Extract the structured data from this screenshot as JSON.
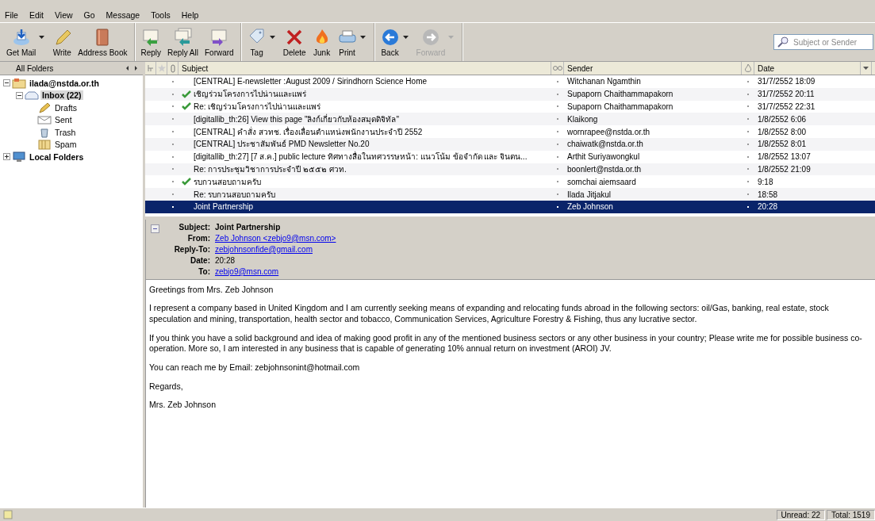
{
  "menu": [
    "File",
    "Edit",
    "View",
    "Go",
    "Message",
    "Tools",
    "Help"
  ],
  "toolbar": [
    [
      {
        "label": "Get Mail",
        "kind": "getmail",
        "dropdown": true,
        "disabled": false
      },
      {
        "label": "Write",
        "kind": "write",
        "dropdown": false,
        "disabled": false
      },
      {
        "label": "Address Book",
        "kind": "addressbook",
        "dropdown": false,
        "disabled": false
      }
    ],
    [
      {
        "label": "Reply",
        "kind": "reply",
        "dropdown": false,
        "disabled": false
      },
      {
        "label": "Reply All",
        "kind": "replyall",
        "dropdown": false,
        "disabled": false
      },
      {
        "label": "Forward",
        "kind": "forward",
        "dropdown": false,
        "disabled": false
      }
    ],
    [
      {
        "label": "Tag",
        "kind": "tag",
        "dropdown": true,
        "disabled": false
      },
      {
        "label": "Delete",
        "kind": "delete",
        "dropdown": false,
        "disabled": false
      },
      {
        "label": "Junk",
        "kind": "junk",
        "dropdown": false,
        "disabled": false
      },
      {
        "label": "Print",
        "kind": "print",
        "dropdown": true,
        "disabled": false
      }
    ],
    [
      {
        "label": "Back",
        "kind": "back",
        "dropdown": true,
        "disabled": false
      },
      {
        "label": "Forward",
        "kind": "next",
        "dropdown": true,
        "disabled": true
      }
    ]
  ],
  "search": {
    "placeholder": "Subject or Sender"
  },
  "folders": {
    "header": "All Folders",
    "tree": [
      {
        "label": "ilada@nstda.or.th",
        "kind": "account",
        "expanded": true,
        "selected": false,
        "children": [
          {
            "label": "Inbox (22)",
            "kind": "inbox",
            "expanded": true,
            "selected": true,
            "children": [
              {
                "label": "Drafts",
                "kind": "drafts",
                "selected": false
              },
              {
                "label": "Sent",
                "kind": "sent",
                "selected": false
              },
              {
                "label": "Trash",
                "kind": "trash",
                "selected": false
              },
              {
                "label": "Spam",
                "kind": "spam",
                "selected": false
              }
            ]
          }
        ]
      },
      {
        "label": "Local Folders",
        "kind": "local",
        "expanded": false,
        "selected": false
      }
    ]
  },
  "columns": {
    "subject": "Subject",
    "sender": "Sender",
    "date": "Date"
  },
  "messages": [
    {
      "subject": "[CENTRAL] E-newsletter :August 2009 / Sirindhorn Science Home",
      "sender": "Witchanan Ngamthin",
      "date": "31/7/2552 18:09",
      "replied": false,
      "selected": false
    },
    {
      "subject": "เชิญร่วมโครงการไปน่านและแพร่",
      "sender": "Supaporn Chaithammapakorn",
      "date": "31/7/2552 20:11",
      "replied": true,
      "selected": false
    },
    {
      "subject": "Re: เชิญร่วมโครงการไปน่านและแพร่",
      "sender": "Supaporn Chaithammapakorn",
      "date": "31/7/2552 22:31",
      "replied": true,
      "selected": false
    },
    {
      "subject": "[digitallib_th:26] View this page \"ลิงก์เกี่ยวกับห้องสมุดดิจิทัล\"",
      "sender": "Klaikong",
      "date": "1/8/2552 6:06",
      "replied": false,
      "selected": false
    },
    {
      "subject": "[CENTRAL] คำสั่ง สวทช. เรื่องเลื่อนตำแหน่งพนักงานประจำปี 2552",
      "sender": "wornrapee@nstda.or.th",
      "date": "1/8/2552 8:00",
      "replied": false,
      "selected": false
    },
    {
      "subject": "[CENTRAL] ประชาสัมพันธ์ PMD Newsletter No.20",
      "sender": "chaiwatk@nstda.or.th",
      "date": "1/8/2552 8:01",
      "replied": false,
      "selected": false
    },
    {
      "subject": "[digitallib_th:27] [7 ส.ค.] public lecture ทิศทางสื่อในทศวรรษหน้า: แนวโน้ม ข้อจำกัด และ จินตน...",
      "sender": "Arthit Suriyawongkul",
      "date": "1/8/2552 13:07",
      "replied": false,
      "selected": false
    },
    {
      "subject": "Re: การประชุมวิชาการประจำปี ๒๕๕๒ ศวท.",
      "sender": "boonlert@nstda.or.th",
      "date": "1/8/2552 21:09",
      "replied": false,
      "selected": false
    },
    {
      "subject": "รบกวนสอบถามครับ",
      "sender": "somchai aiemsaard",
      "date": "9:18",
      "replied": true,
      "selected": false
    },
    {
      "subject": "Re: รบกวนสอบถามครับ",
      "sender": "Ilada Jitjakul",
      "date": "18:58",
      "replied": false,
      "selected": false
    },
    {
      "subject": "Joint Partnership",
      "sender": "Zeb Johnson",
      "date": "20:28",
      "replied": false,
      "selected": true
    }
  ],
  "header": [
    {
      "label": "Subject:",
      "value": "Joint Partnership",
      "kind": "bold"
    },
    {
      "label": "From:",
      "value": "Zeb Johnson <zebjo9@msn.com>",
      "kind": "link"
    },
    {
      "label": "Reply-To:",
      "value": "zebjohnsonfide@gmail.com",
      "kind": "link"
    },
    {
      "label": "Date:",
      "value": "20:28",
      "kind": "plain"
    },
    {
      "label": "To:",
      "value": "zebjo9@msn.com",
      "kind": "link"
    }
  ],
  "body": [
    "Greetings from Mrs. Zeb Johnson",
    "I represent a company based in United Kingdom and I am currently seeking means of expanding and relocating funds abroad in the following sectors: oil/Gas, banking, real estate, stock speculation and mining, transportation, health sector and tobacco, Communication Services, Agriculture Forestry & Fishing, thus any lucrative sector.",
    "If you think you have a solid background and idea of making good profit in any of the mentioned business sectors or any other business in your country; Please write me for possible business co-operation. More so, I am interested in any business that is capable of generating 10% annual return on investment (AROI) JV.",
    "You can reach me by Email: zebjohnsonint@hotmail.com",
    "Regards,",
    "Mrs. Zeb Johnson"
  ],
  "status": {
    "unread": "Unread: 22",
    "total": "Total: 1519"
  }
}
